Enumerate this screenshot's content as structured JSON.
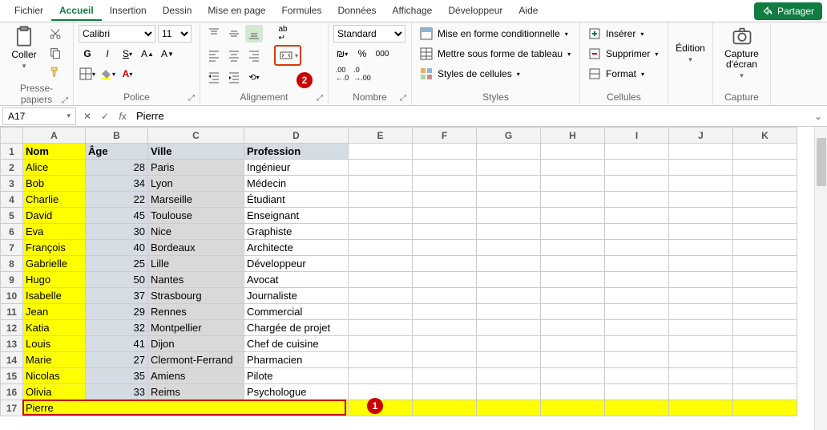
{
  "tabs": {
    "items": [
      "Fichier",
      "Accueil",
      "Insertion",
      "Dessin",
      "Mise en page",
      "Formules",
      "Données",
      "Affichage",
      "Développeur",
      "Aide"
    ],
    "active": 1
  },
  "share": "Partager",
  "ribbon": {
    "clipboard": {
      "paste": "Coller",
      "label": "Presse-papiers"
    },
    "font": {
      "name": "Calibri",
      "size": "11",
      "label": "Police"
    },
    "align": {
      "label": "Alignement"
    },
    "number": {
      "format": "Standard",
      "label": "Nombre"
    },
    "styles": {
      "cond": "Mise en forme conditionnelle",
      "table": "Mettre sous forme de tableau",
      "cell": "Styles de cellules",
      "label": "Styles"
    },
    "cells": {
      "insert": "Insérer",
      "delete": "Supprimer",
      "format": "Format",
      "label": "Cellules"
    },
    "edit": {
      "label": "Édition"
    },
    "capture": {
      "btn": "Capture d'écran",
      "label": "Capture"
    }
  },
  "namebox": "A17",
  "formula": "Pierre",
  "columns": [
    "A",
    "B",
    "C",
    "D",
    "E",
    "F",
    "G",
    "H",
    "I",
    "J",
    "K"
  ],
  "data": {
    "headers": [
      "Nom",
      "Âge",
      "Ville",
      "Profession"
    ],
    "rows": [
      [
        "Alice",
        28,
        "Paris",
        "Ingénieur"
      ],
      [
        "Bob",
        34,
        "Lyon",
        "Médecin"
      ],
      [
        "Charlie",
        22,
        "Marseille",
        "Étudiant"
      ],
      [
        "David",
        45,
        "Toulouse",
        "Enseignant"
      ],
      [
        "Eva",
        30,
        "Nice",
        "Graphiste"
      ],
      [
        "François",
        40,
        "Bordeaux",
        "Architecte"
      ],
      [
        "Gabrielle",
        25,
        "Lille",
        "Développeur"
      ],
      [
        "Hugo",
        50,
        "Nantes",
        "Avocat"
      ],
      [
        "Isabelle",
        37,
        "Strasbourg",
        "Journaliste"
      ],
      [
        "Jean",
        29,
        "Rennes",
        "Commercial"
      ],
      [
        "Katia",
        32,
        "Montpellier",
        "Chargée de projet"
      ],
      [
        "Louis",
        41,
        "Dijon",
        "Chef de cuisine"
      ],
      [
        "Marie",
        27,
        "Clermont-Ferrand",
        "Pharmacien"
      ],
      [
        "Nicolas",
        35,
        "Amiens",
        "Pilote"
      ],
      [
        "Olivia",
        33,
        "Reims",
        "Psychologue"
      ]
    ],
    "row17": "Pierre"
  },
  "annot": {
    "one": "1",
    "two": "2"
  }
}
